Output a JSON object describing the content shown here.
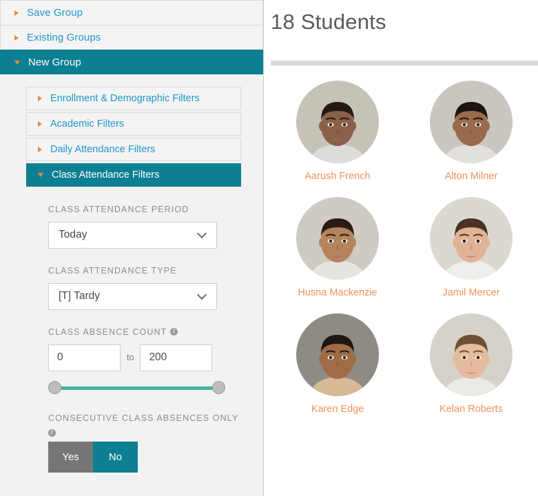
{
  "filter_panel": {
    "top_accordions": [
      {
        "label": "Save Group",
        "state": "collapsed"
      },
      {
        "label": "Existing Groups",
        "state": "collapsed"
      },
      {
        "label": "New Group",
        "state": "expanded"
      }
    ],
    "sub_accordions": [
      {
        "label": "Enrollment & Demographic Filters",
        "state": "collapsed"
      },
      {
        "label": "Academic Filters",
        "state": "collapsed"
      },
      {
        "label": "Daily Attendance Filters",
        "state": "collapsed"
      },
      {
        "label": "Class Attendance Filters",
        "state": "expanded"
      }
    ],
    "fields": {
      "period": {
        "label": "CLASS ATTENDANCE PERIOD",
        "value": "Today",
        "chevron_icon": "chevron-down-icon"
      },
      "type": {
        "label": "CLASS ATTENDANCE TYPE",
        "value": "[T] Tardy",
        "chevron_icon": "chevron-down-icon"
      },
      "absence_count": {
        "label": "CLASS ABSENCE COUNT",
        "info_icon": "info-icon",
        "min_value": "0",
        "max_value": "200",
        "separator": "to",
        "slider_min_pct": 0,
        "slider_max_pct": 100
      },
      "consecutive": {
        "label": "CONSECUTIVE CLASS ABSENCES ONLY",
        "info_icon": "info-icon",
        "yes_label": "Yes",
        "no_label": "No",
        "selected": "No"
      }
    }
  },
  "students_panel": {
    "title": "18 Students",
    "students": [
      {
        "name": "Aarush French",
        "skin": "#8a6048",
        "hair": "#241a14",
        "bg": "#c6c2b8",
        "shirt": "#dcdcd8"
      },
      {
        "name": "Alton Milner",
        "skin": "#9a6a4c",
        "hair": "#1d1510",
        "bg": "#c9c6c0",
        "shirt": "#e2e0da"
      },
      {
        "name": "Husna Mackenzie",
        "skin": "#b5835e",
        "hair": "#2a1c12",
        "bg": "#cfcbc3",
        "shirt": "#e6e4de"
      },
      {
        "name": "Jamil Mercer",
        "skin": "#e0b396",
        "hair": "#4a3324",
        "bg": "#ddd8cf",
        "shirt": "#f0eee9"
      },
      {
        "name": "Karen Edge",
        "skin": "#a06c46",
        "hair": "#201610",
        "bg": "#8e8a84",
        "shirt": "#d8b896"
      },
      {
        "name": "Kelan Roberts",
        "skin": "#e4bb9c",
        "hair": "#6b5134",
        "bg": "#d6d2ca",
        "shirt": "#eceae5"
      }
    ]
  },
  "colors": {
    "accent_teal": "#0d7f92",
    "accent_orange": "#e8883a",
    "link_blue": "#2196c9",
    "name_orange": "#f0925a",
    "slider_green": "#3fb89a",
    "toggle_gray": "#767676"
  }
}
